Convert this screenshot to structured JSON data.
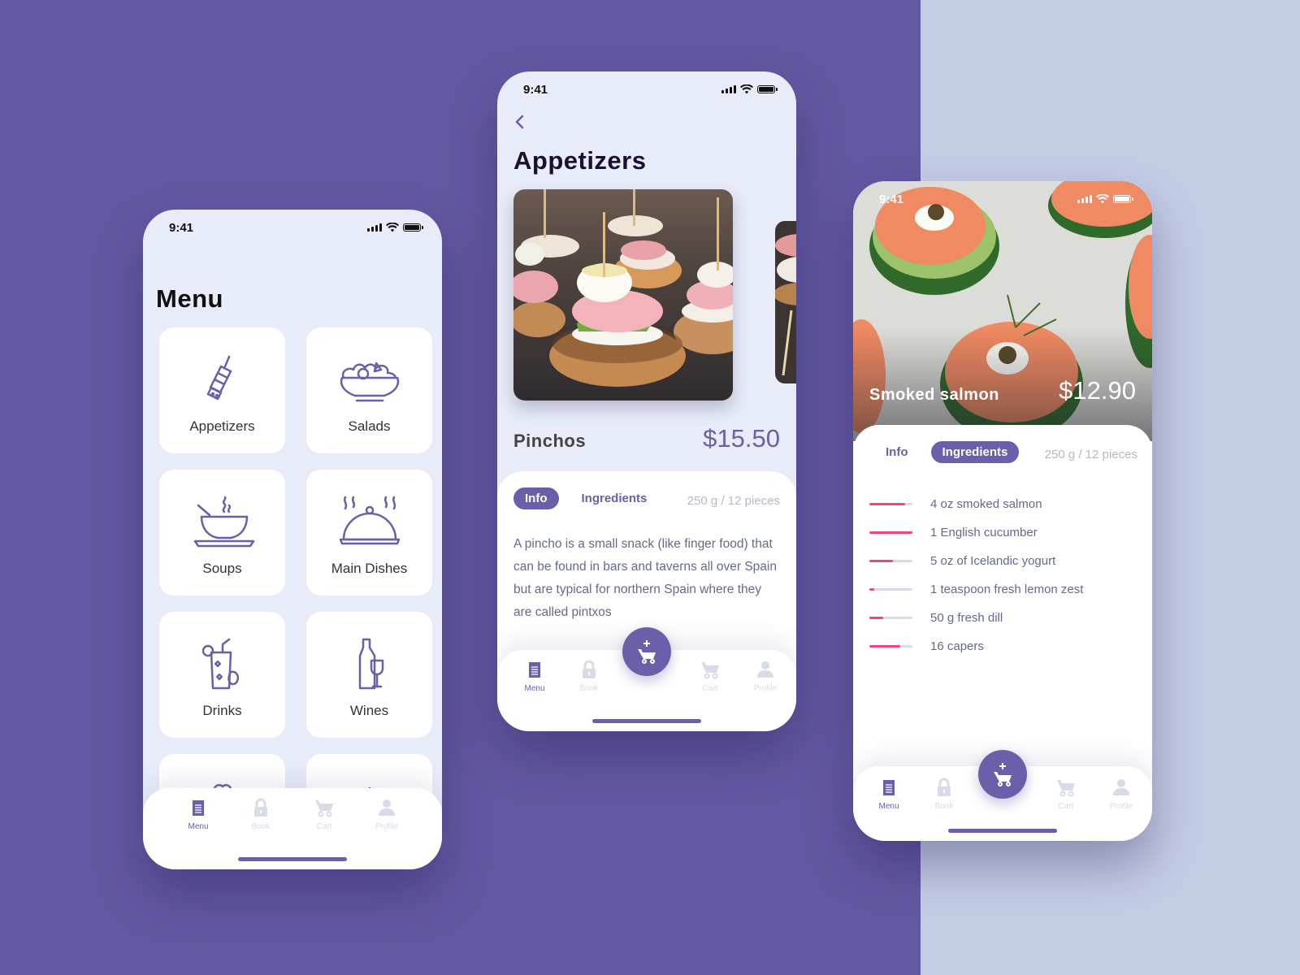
{
  "colors": {
    "accent": "#6a5fa8",
    "background_left": "#6359a2",
    "background_right": "#c4cde6",
    "ingredient_bar": "#f0457e",
    "inactive_tab": "#d7dbea"
  },
  "status_bar": {
    "time": "9:41"
  },
  "tabbar": {
    "items": [
      {
        "label": "Menu",
        "icon": "menu-icon",
        "active": true
      },
      {
        "label": "Book",
        "icon": "lock-icon",
        "active": false
      },
      {
        "label": "Cart",
        "icon": "cart-icon",
        "active": false
      },
      {
        "label": "Profile",
        "icon": "profile-icon",
        "active": false
      }
    ],
    "fab_icon": "add-to-cart-icon"
  },
  "menu_screen": {
    "title": "Menu",
    "categories": [
      {
        "label": "Appetizers",
        "icon": "skewer-icon"
      },
      {
        "label": "Salads",
        "icon": "salad-bowl-icon"
      },
      {
        "label": "Soups",
        "icon": "soup-bowl-icon"
      },
      {
        "label": "Main Dishes",
        "icon": "cloche-icon"
      },
      {
        "label": "Drinks",
        "icon": "cocktail-icon"
      },
      {
        "label": "Wines",
        "icon": "wine-icon"
      },
      {
        "label": "",
        "icon": "heart-dish-icon"
      },
      {
        "label": "",
        "icon": "steam-icon"
      }
    ]
  },
  "detail_screen": {
    "back_icon": "chevron-left-icon",
    "title": "Appetizers",
    "item_name": "Pinchos",
    "price": "$15.50",
    "tabs": [
      {
        "label": "Info",
        "active": true
      },
      {
        "label": "Ingredients",
        "active": false
      }
    ],
    "weight": "250 g / 12 pieces",
    "description": "A pincho is a small snack (like finger food) that can be found in bars and taverns all over Spain but are typical for northern Spain where they are called pintxos"
  },
  "ingredients_screen": {
    "item_name": "Smoked salmon",
    "price": "$12.90",
    "tabs": [
      {
        "label": "Info",
        "active": false
      },
      {
        "label": "Ingredients",
        "active": true
      }
    ],
    "weight": "250 g / 12 pieces",
    "ingredients": [
      {
        "text": "4 oz smoked salmon",
        "level": 0.83
      },
      {
        "text": "1 English cucumber",
        "level": 1.0
      },
      {
        "text": "5 oz of Icelandic yogurt",
        "level": 0.55
      },
      {
        "text": "1 teaspoon fresh lemon zest",
        "level": 0.12
      },
      {
        "text": "50 g fresh dill",
        "level": 0.33
      },
      {
        "text": "16 capers",
        "level": 0.72
      }
    ]
  }
}
